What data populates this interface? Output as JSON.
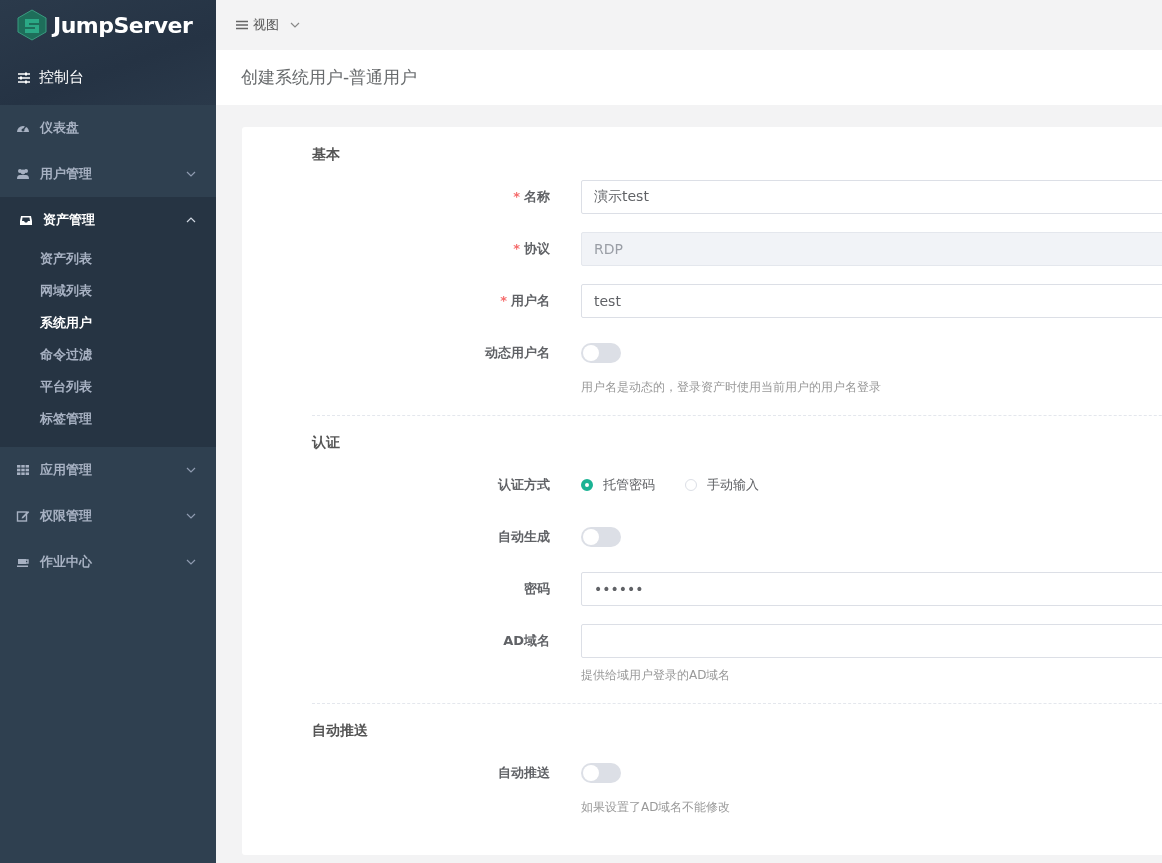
{
  "logo": {
    "text": "JumpServer"
  },
  "sidebar": {
    "header": "控制台",
    "items": [
      {
        "label": "仪表盘",
        "expandable": false,
        "expanded": false
      },
      {
        "label": "用户管理",
        "expandable": true,
        "expanded": false
      },
      {
        "label": "资产管理",
        "expandable": true,
        "expanded": true,
        "children": [
          {
            "label": "资产列表",
            "selected": false
          },
          {
            "label": "网域列表",
            "selected": false
          },
          {
            "label": "系统用户",
            "selected": true
          },
          {
            "label": "命令过滤",
            "selected": false
          },
          {
            "label": "平台列表",
            "selected": false
          },
          {
            "label": "标签管理",
            "selected": false
          }
        ]
      },
      {
        "label": "应用管理",
        "expandable": true,
        "expanded": false
      },
      {
        "label": "权限管理",
        "expandable": true,
        "expanded": false
      },
      {
        "label": "作业中心",
        "expandable": true,
        "expanded": false
      }
    ]
  },
  "topbar": {
    "menu": "视图"
  },
  "page_title": "创建系统用户-普通用户",
  "sections": [
    {
      "title": "基本",
      "fields": [
        {
          "kind": "input",
          "label": "名称",
          "required_mark": "*",
          "value": "演示test",
          "disabled": false
        },
        {
          "kind": "input",
          "label": "协议",
          "required_mark": "*",
          "value": "RDP",
          "disabled": true
        },
        {
          "kind": "input",
          "label": "用户名",
          "required_mark": "*",
          "value": "test",
          "disabled": false
        },
        {
          "kind": "toggle",
          "label": "动态用户名",
          "on": false,
          "help": "用户名是动态的，登录资产时使用当前用户的用户名登录"
        }
      ]
    },
    {
      "title": "认证",
      "fields": [
        {
          "kind": "radio",
          "label": "认证方式",
          "options": [
            {
              "label": "托管密码",
              "selected": true
            },
            {
              "label": "手动输入",
              "selected": false
            }
          ]
        },
        {
          "kind": "toggle",
          "label": "自动生成",
          "on": false
        },
        {
          "kind": "input",
          "label": "密码",
          "value": "••••••",
          "disabled": false
        },
        {
          "kind": "input",
          "label": "AD域名",
          "disabled": false,
          "help": "提供给域用户登录的AD域名"
        }
      ]
    },
    {
      "title": "自动推送",
      "fields": [
        {
          "kind": "toggle",
          "label": "自动推送",
          "on": false,
          "help": "如果设置了AD域名不能修改"
        }
      ]
    }
  ]
}
